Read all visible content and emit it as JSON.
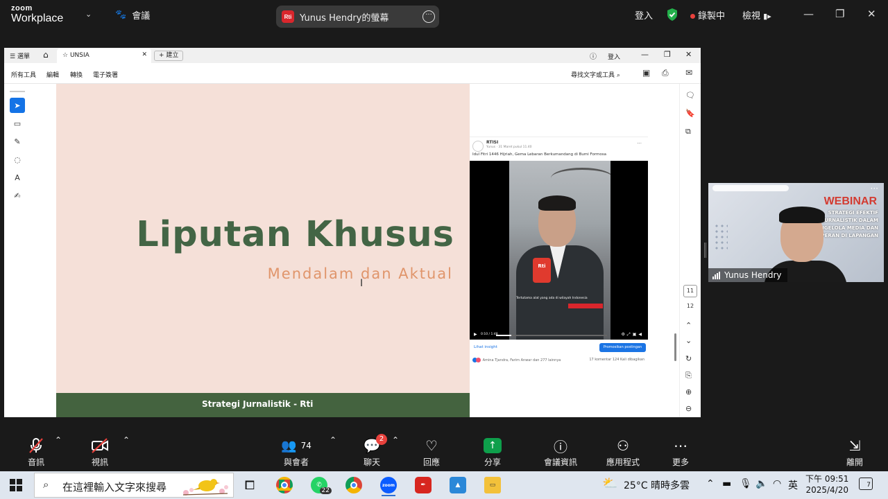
{
  "zoom": {
    "logo_line1": "zoom",
    "logo_line2": "Workplace",
    "meeting_label": "會議",
    "share_title": "Yunus Hendry的螢幕",
    "rti_logo": "Rti",
    "sign_in": "登入",
    "recording": "錄製中",
    "view": "檢視"
  },
  "acrobat": {
    "menu": "選單",
    "tab_title": "UNSIA",
    "new_tab": "建立",
    "sign_in": "登入",
    "menus": [
      "所有工具",
      "編輯",
      "轉換",
      "電子簽署"
    ],
    "find": "尋找文字或工具",
    "page_current": "11",
    "page_total": "12"
  },
  "slide": {
    "title": "Liputan Khusus",
    "subtitle": "Mendalam dan Aktual",
    "footer": "Strategi Jurnalistik - Rti"
  },
  "fb_post": {
    "page_name": "RTISI",
    "meta": "Yunus · 31 Maret pukul 11.40",
    "caption": "Idul Fitri 1446 Hijriah, Gema Lebaran Berkumandang di Bumi Formosa",
    "video_caption": "Tertutama alat yang ada di wilayah Indonesia",
    "time": "0:10 / 1:48",
    "insight": "Lihat insight",
    "promote": "Promosikan postingan",
    "reactions": "Amina Tjandra, Farim Anwar dan 277 lainnya",
    "stats": "17 komentar   124 Kali dibagikan"
  },
  "video_tile": {
    "webinar": "WEBINAR",
    "lines": [
      "STRATEGI EFEKTIF",
      "JURNALISTIK DALAM",
      "MENGELOLA MEDIA DAN",
      "PERAN DI LAPANGAN"
    ],
    "participant": "Yunus Hendry"
  },
  "toolbar": {
    "audio": "音訊",
    "video": "視訊",
    "participants": "與會者",
    "participant_count": "74",
    "chat": "聊天",
    "chat_badge": "2",
    "react": "回應",
    "share": "分享",
    "info": "會議資訊",
    "apps": "應用程式",
    "more": "更多",
    "leave": "離開"
  },
  "taskbar": {
    "search_placeholder": "在這裡輸入文字來搜尋",
    "whatsapp_badge": "22",
    "weather": "25°C  晴時多雲",
    "ime": "英",
    "time": "下午 09:51",
    "date": "2025/4/20",
    "notif_count": "7"
  },
  "colors": {
    "slide_bg": "#f5e0d8",
    "slide_green": "#436545",
    "slide_orange": "#e0956b",
    "zoom_bg": "#1a1a1a",
    "record_red": "#e8413c",
    "share_green": "#0e9f4b",
    "fb_blue": "#1b74e4"
  }
}
